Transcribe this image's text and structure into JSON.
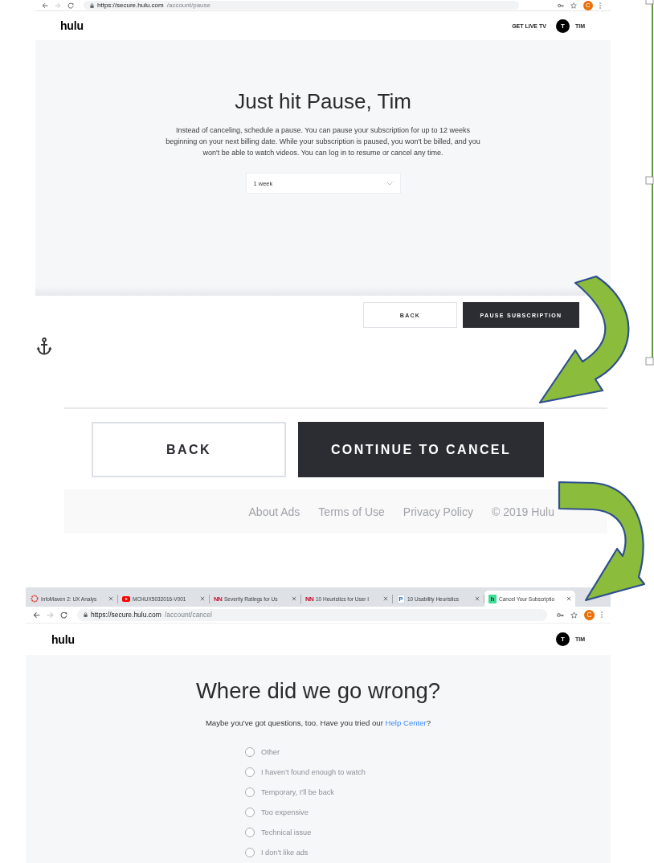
{
  "top_screenshot": {
    "browser": {
      "url_host": "https://secure.hulu.com",
      "url_path": "/account/pause",
      "profile_initial": "C"
    },
    "header": {
      "logo": "hulu",
      "live_tv_link": "GET LIVE TV",
      "avatar_initial": "T",
      "user_name": "TIM"
    },
    "title": "Just hit Pause, Tim",
    "description": "Instead of canceling, schedule a pause. You can pause your subscription for up to 12 weeks beginning on your next billing date. While your subscription is paused, you won't be billed, and you won't be able to watch videos. You can log in to resume or cancel any time.",
    "duration_select": {
      "value": "1 week"
    },
    "buttons": [
      {
        "label": "BACK",
        "kind": "secondary"
      },
      {
        "label": "PAUSE SUBSCRIPTION",
        "kind": "primary"
      }
    ]
  },
  "zoomed_buttons": [
    {
      "label": "BACK",
      "kind": "secondary"
    },
    {
      "label": "CONTINUE TO CANCEL",
      "kind": "primary"
    }
  ],
  "footer": {
    "links": [
      "About Ads",
      "Terms of Use",
      "Privacy Policy"
    ],
    "copyright": "© 2019 Hulu"
  },
  "bottom_screenshot": {
    "tabs": [
      {
        "title": "InfoMaven 2: UX Analys",
        "kind": "ring",
        "selected": false
      },
      {
        "title": "MCHUX5032016-V001",
        "kind": "play",
        "selected": false
      },
      {
        "title": "Severity Ratings for Us",
        "kind": "nn",
        "icon_text": "NN",
        "selected": false
      },
      {
        "title": "10 Heuristics for User I",
        "kind": "nn",
        "icon_text": "NN",
        "selected": false
      },
      {
        "title": "10 Usability Heuristics",
        "kind": "p",
        "icon_text": "P",
        "selected": false
      },
      {
        "title": "Cancel Your Subscriptio",
        "kind": "h",
        "icon_text": "h",
        "selected": true
      }
    ],
    "browser": {
      "url_host": "https://secure.hulu.com",
      "url_path": "/account/cancel",
      "profile_initial": "C"
    },
    "header": {
      "logo": "hulu",
      "avatar_initial": "T",
      "user_name": "TIM"
    },
    "title": "Where did we go wrong?",
    "intro": {
      "text": "Maybe you've got questions, too. Have you tried our ",
      "link": "Help Center",
      "after": "?"
    },
    "reasons": [
      {
        "label": "Other",
        "selected": false
      },
      {
        "label": "I haven't found enough to watch",
        "selected": false
      },
      {
        "label": "Temporary, I'll be back",
        "selected": false
      },
      {
        "label": "Too expensive",
        "selected": false
      },
      {
        "label": "Technical issue",
        "selected": false
      },
      {
        "label": "I don't like ads",
        "selected": false
      }
    ]
  }
}
